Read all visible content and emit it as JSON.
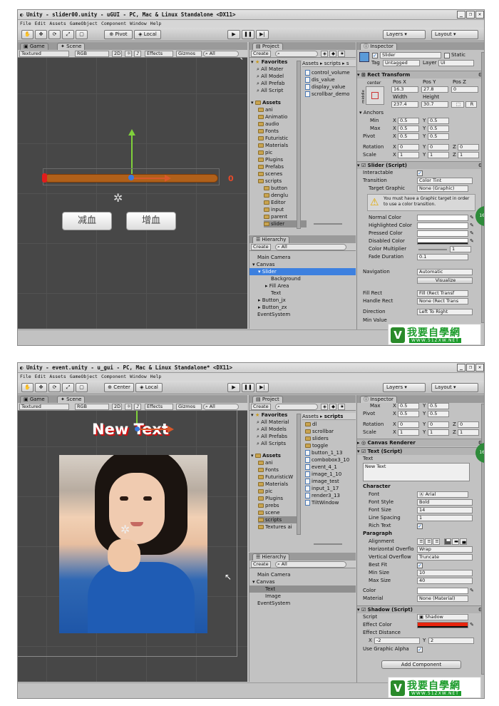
{
  "shot1": {
    "title": "Unity - slider00.unity - uGUI - PC, Mac & Linux Standalone <DX11>",
    "menu": [
      "File",
      "Edit",
      "Assets",
      "GameObject",
      "Component",
      "Window",
      "Help"
    ],
    "pivot": "Pivot",
    "local": "Local",
    "layers": "Layers",
    "layout": "Layout",
    "tabs": {
      "game": "Game",
      "scene": "Scene",
      "project": "Project",
      "inspector": "Inspector",
      "hierarchy": "Hierarchy"
    },
    "scene_bar": {
      "render": "Textured",
      "color": "RGB",
      "mode2d": "2D",
      "effects": "Effects",
      "gizmos": "Gizmos",
      "search": "All"
    },
    "scene_content": {
      "slider_value": "0",
      "btn_minus": "减血",
      "btn_plus": "增血"
    },
    "project": {
      "create": "Create",
      "favorites_label": "Favorites",
      "favorites": [
        "All Mater",
        "All Model",
        "All Prefab",
        "All Script"
      ],
      "assets_label": "Assets",
      "assets": [
        "ani",
        "Animatio",
        "audio",
        "Fonts",
        "Futuristic",
        "Materials",
        "pic",
        "Plugins",
        "Prefabs",
        "scenes",
        "scripts",
        "button",
        "denglu",
        "Editor",
        "input",
        "parent",
        "slider"
      ],
      "breadcrumb": [
        "Assets",
        "scripts",
        "s"
      ],
      "files": [
        "control_volume",
        "dis_value",
        "display_value",
        "scrollbar_demo"
      ]
    },
    "hierarchy": {
      "create": "Create",
      "search": "All",
      "items": [
        "Main Camera",
        "Canvas",
        "Slider",
        "Background",
        "Fill Area",
        "Text",
        "Button_jx",
        "Button_zx",
        "EventSystem"
      ]
    },
    "inspector": {
      "name": "Slider",
      "static": "Static",
      "tag_label": "Tag",
      "tag": "Untagged",
      "layer_label": "Layer",
      "layer": "UI",
      "rect_header": "Rect Transform",
      "anchor_preset": "center",
      "anchor_side": "middle",
      "pos_labels": [
        "Pos X",
        "Pos Y",
        "Pos Z"
      ],
      "pos": [
        "16.3",
        "27.8",
        "0"
      ],
      "wh_labels": [
        "Width",
        "Height"
      ],
      "wh": [
        "237.4",
        "30.7"
      ],
      "anchors_label": "Anchors",
      "min_label": "Min",
      "max_label": "Max",
      "pivot_label": "Pivot",
      "min": [
        "0.5",
        "0.5"
      ],
      "max": [
        "0.5",
        "0.5"
      ],
      "pivot": [
        "0.5",
        "0.5"
      ],
      "rotation_label": "Rotation",
      "rotation": [
        "0",
        "0",
        "0"
      ],
      "scale_label": "Scale",
      "scale": [
        "1",
        "1",
        "1"
      ],
      "slider_header": "Slider (Script)",
      "interactable": "Interactable",
      "transition_label": "Transition",
      "transition": "Color Tint",
      "target_graphic_label": "Target Graphic",
      "target_graphic": "None (Graphic)",
      "warning": "You must have a Graphic target in order to use a color transition.",
      "normal_color": "Normal Color",
      "highlighted_color": "Highlighted Color",
      "pressed_color": "Pressed Color",
      "disabled_color": "Disabled Color",
      "color_multiplier": "Color Multiplier",
      "color_multiplier_value": "1",
      "fade_duration": "Fade Duration",
      "fade_value": "0.1",
      "navigation_label": "Navigation",
      "navigation": "Automatic",
      "visualize": "Visualize",
      "fill_rect_label": "Fill Rect",
      "fill_rect": "Fill (Rect Transf",
      "handle_rect_label": "Handle Rect",
      "handle_rect": "None (Rect Trans",
      "direction_label": "Direction",
      "direction": "Left To Right",
      "min_value_label": "Min Value"
    },
    "badge": "16"
  },
  "shot2": {
    "title": "Unity - event.unity - u_gui - PC, Mac & Linux Standalone* <DX11>",
    "menu": [
      "File",
      "Edit",
      "Assets",
      "GameObject",
      "Component",
      "Window",
      "Help"
    ],
    "center": "Center",
    "local": "Local",
    "layers": "Layers",
    "layout": "Layout",
    "tabs": {
      "game": "Game",
      "scene": "Scene",
      "project": "Project",
      "inspector": "Inspector",
      "hierarchy": "Hierarchy"
    },
    "scene_bar": {
      "render": "Textured",
      "color": "RGB",
      "mode2d": "2D",
      "effects": "Effects",
      "gizmos": "Gizmos",
      "search": "All"
    },
    "scene_content": {
      "text": "New Text"
    },
    "project": {
      "create": "Create",
      "favorites_label": "Favorites",
      "favorites": [
        "All Material",
        "All Models",
        "All Prefabs",
        "All Scripts"
      ],
      "assets_label": "Assets",
      "assets": [
        "ani",
        "Fonts",
        "FuturisticW",
        "Materials",
        "pic",
        "Plugins",
        "prebs",
        "scene",
        "scripts",
        "Textures ai"
      ],
      "breadcrumb": [
        "Assets",
        "scripts"
      ],
      "files": [
        "dl",
        "scrollbar",
        "sliders",
        "toggle",
        "button_1_13",
        "combobox3_10",
        "event_4_1",
        "image_1_10",
        "image_test",
        "input_1_17",
        "render3_13",
        "TiltWindow"
      ]
    },
    "hierarchy": {
      "create": "Create",
      "search": "All",
      "items": [
        "Main Camera",
        "Canvas",
        "Text",
        "Image",
        "EventSystem"
      ]
    },
    "inspector": {
      "max_label": "Max",
      "max": [
        "0.5",
        "0.5"
      ],
      "pivot_label": "Pivot",
      "pivot": [
        "0.5",
        "0.5"
      ],
      "rotation_label": "Rotation",
      "rotation": [
        "0",
        "0",
        "0"
      ],
      "scale_label": "Scale",
      "scale": [
        "1",
        "1",
        "1"
      ],
      "canvas_renderer": "Canvas Renderer",
      "text_header": "Text (Script)",
      "text_label": "Text",
      "text_value": "New Text",
      "character": "Character",
      "font_label": "Font",
      "font": "Arial",
      "font_style_label": "Font Style",
      "font_style": "Bold",
      "font_size_label": "Font Size",
      "font_size": "14",
      "line_spacing_label": "Line Spacing",
      "line_spacing": "1",
      "rich_text_label": "Rich Text",
      "paragraph": "Paragraph",
      "alignment_label": "Alignment",
      "hoverflow_label": "Horizontal Overflo",
      "hoverflow": "Wrap",
      "voverflow_label": "Vertical Overflow",
      "voverflow": "Truncate",
      "best_fit_label": "Best Fit",
      "min_size_label": "Min Size",
      "min_size": "10",
      "max_size_label": "Max Size",
      "max_size": "40",
      "color_label": "Color",
      "material_label": "Material",
      "material": "None (Material)",
      "shadow_header": "Shadow (Script)",
      "script_label": "Script",
      "script": "Shadow",
      "effect_color_label": "Effect Color",
      "effect_distance_label": "Effect Distance",
      "dist": [
        "-2",
        "2"
      ],
      "use_alpha_label": "Use Graphic Alpha",
      "add_component": "Add Component"
    },
    "badge": "16"
  },
  "watermark": {
    "text": "我要自學網",
    "url": "WWW.51ZXW.NET",
    "logo": "V"
  }
}
